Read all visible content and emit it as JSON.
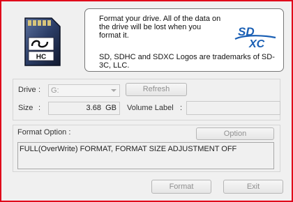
{
  "info": {
    "message": "Format your drive. All of the data on the drive will be lost when you format it.",
    "trademark": "SD, SDHC and SDXC Logos are trademarks of SD-3C, LLC.",
    "card_label": "HC",
    "logo_sd": "SD",
    "logo_xc": "XC"
  },
  "drive": {
    "label": "Drive",
    "colon": ":",
    "value": "G:",
    "refresh_label": "Refresh"
  },
  "size": {
    "label": "Size",
    "colon": ":",
    "value": "3.68",
    "unit": "GB"
  },
  "volume": {
    "label": "Volume Label",
    "colon": ":",
    "value": ""
  },
  "format_option": {
    "label": "Format Option :",
    "button_label": "Option",
    "description": "FULL(OverWrite) FORMAT, FORMAT SIZE ADJUSTMENT OFF"
  },
  "actions": {
    "format_label": "Format",
    "exit_label": "Exit"
  },
  "colors": {
    "window_border": "#e0001a",
    "logo_blue": "#1a5fb4"
  }
}
